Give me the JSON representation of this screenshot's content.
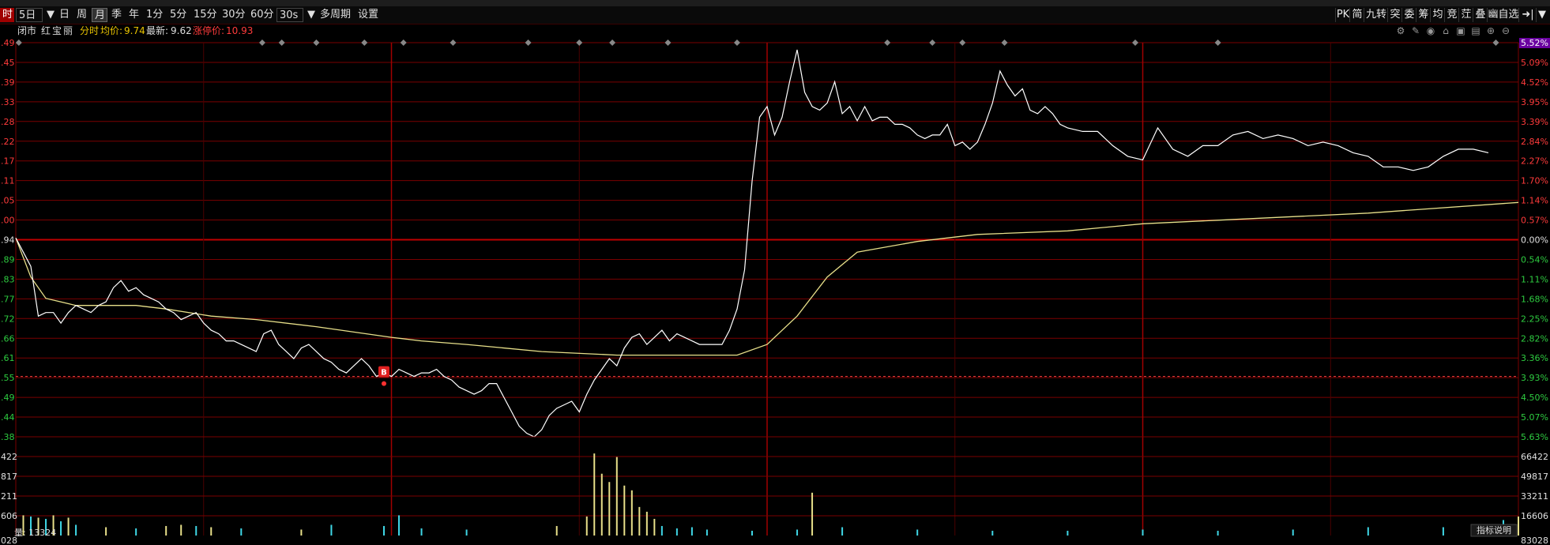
{
  "toolbar": {
    "left_items": [
      {
        "label": "时",
        "style": "red"
      },
      {
        "label": "5日",
        "style": "boxed"
      },
      {
        "label": "▼",
        "style": "plain"
      },
      {
        "label": "日",
        "style": "plain"
      },
      {
        "label": "周",
        "style": "plain"
      },
      {
        "label": "月",
        "style": "active"
      },
      {
        "label": "季",
        "style": "plain"
      },
      {
        "label": "年",
        "style": "plain"
      },
      {
        "label": "1分",
        "style": "plain"
      },
      {
        "label": "5分",
        "style": "plain"
      },
      {
        "label": "15分",
        "style": "plain"
      },
      {
        "label": "30分",
        "style": "plain"
      },
      {
        "label": "60分",
        "style": "plain"
      },
      {
        "label": "30s",
        "style": "boxed"
      },
      {
        "label": "▼",
        "style": "plain"
      },
      {
        "label": "多周期",
        "style": "plain"
      },
      {
        "label": "设置",
        "style": "plain"
      }
    ],
    "right_items": [
      "PK",
      "简",
      "九转",
      "突",
      "委",
      "筹",
      "均",
      "竞",
      "茳",
      "叠",
      "幽自选",
      "➜|",
      "▼"
    ]
  },
  "info": {
    "market": "闭市",
    "stock_name": "红宝丽",
    "mode": "分时",
    "avg_label": "均价:",
    "avg_value": "9.74",
    "last_label": "最新:",
    "last_value": "9.62",
    "limit_label": "涨停价:",
    "limit_value": "10.93"
  },
  "icons": [
    "gear-icon",
    "pen-icon",
    "eye-icon",
    "lock-icon",
    "trash-icon",
    "copy-icon",
    "zoom-in-icon",
    "zoom-out-icon"
  ],
  "colors": {
    "up": "#ff3b3b",
    "down": "#2ecc40",
    "flat": "#e0e0e0",
    "price_line": "#ffffff",
    "avg_line": "#e8e08a",
    "vol_up": "#e8e08a",
    "vol_down": "#3fd7e6",
    "grid": "#7a0000"
  },
  "chart_data": {
    "type": "line",
    "title": "",
    "prev_close": 9.94,
    "ylim": [
      9.38,
      10.49
    ],
    "price_ticks_left": [
      ".49",
      ".45",
      ".39",
      ".33",
      ".28",
      ".22",
      ".17",
      ".11",
      ".05",
      ".00",
      ".94",
      ".89",
      ".83",
      ".77",
      ".72",
      ".66",
      ".61",
      ".55",
      ".49",
      ".44",
      ".38"
    ],
    "percent_ticks_right": [
      "5.52%",
      "5.09%",
      "4.52%",
      "3.95%",
      "3.39%",
      "2.84%",
      "2.27%",
      "1.70%",
      "1.14%",
      "0.57%",
      "0.00%",
      "0.54%",
      "1.11%",
      "1.68%",
      "2.25%",
      "2.82%",
      "3.36%",
      "3.93%",
      "4.50%",
      "5.07%",
      "5.63%"
    ],
    "day_boundaries": [
      0.25,
      0.5,
      0.75
    ],
    "price_series": {
      "name": "",
      "x": [
        0,
        0.01,
        0.015,
        0.02,
        0.025,
        0.03,
        0.035,
        0.04,
        0.045,
        0.05,
        0.055,
        0.06,
        0.065,
        0.07,
        0.075,
        0.08,
        0.085,
        0.09,
        0.095,
        0.1,
        0.105,
        0.11,
        0.115,
        0.12,
        0.125,
        0.13,
        0.135,
        0.14,
        0.145,
        0.15,
        0.155,
        0.16,
        0.165,
        0.17,
        0.175,
        0.18,
        0.185,
        0.19,
        0.195,
        0.2,
        0.205,
        0.21,
        0.215,
        0.22,
        0.225,
        0.23,
        0.235,
        0.24,
        0.245,
        0.25,
        0.255,
        0.26,
        0.265,
        0.27,
        0.275,
        0.28,
        0.285,
        0.29,
        0.295,
        0.3,
        0.305,
        0.31,
        0.315,
        0.32,
        0.325,
        0.33,
        0.335,
        0.34,
        0.345,
        0.35,
        0.355,
        0.36,
        0.365,
        0.37,
        0.375,
        0.38,
        0.385,
        0.39,
        0.395,
        0.4,
        0.405,
        0.41,
        0.415,
        0.42,
        0.425,
        0.43,
        0.435,
        0.44,
        0.445,
        0.45,
        0.455,
        0.46,
        0.465,
        0.47,
        0.475,
        0.48,
        0.485,
        0.49,
        0.495,
        0.5,
        0.505,
        0.51,
        0.515,
        0.52,
        0.525,
        0.53,
        0.535,
        0.54,
        0.545,
        0.55,
        0.555,
        0.56,
        0.565,
        0.57,
        0.575,
        0.58,
        0.585,
        0.59,
        0.595,
        0.6,
        0.605,
        0.61,
        0.615,
        0.62,
        0.625,
        0.63,
        0.635,
        0.64,
        0.645,
        0.65,
        0.655,
        0.66,
        0.665,
        0.67,
        0.675,
        0.68,
        0.685,
        0.69,
        0.695,
        0.7,
        0.71,
        0.72,
        0.73,
        0.74,
        0.75,
        0.76,
        0.77,
        0.78,
        0.79,
        0.8,
        0.81,
        0.82,
        0.83,
        0.84,
        0.85,
        0.86,
        0.87,
        0.88,
        0.89,
        0.9,
        0.91,
        0.92,
        0.93,
        0.94,
        0.95,
        0.96,
        0.97,
        0.98,
        0.99,
        1.0
      ],
      "y": [
        9.94,
        9.86,
        9.72,
        9.73,
        9.73,
        9.7,
        9.73,
        9.75,
        9.74,
        9.73,
        9.75,
        9.76,
        9.8,
        9.82,
        9.79,
        9.8,
        9.78,
        9.77,
        9.76,
        9.74,
        9.73,
        9.71,
        9.72,
        9.73,
        9.7,
        9.68,
        9.67,
        9.65,
        9.65,
        9.64,
        9.63,
        9.62,
        9.67,
        9.68,
        9.64,
        9.62,
        9.6,
        9.63,
        9.64,
        9.62,
        9.6,
        9.59,
        9.57,
        9.56,
        9.58,
        9.6,
        9.58,
        9.55,
        9.56,
        9.55,
        9.57,
        9.56,
        9.55,
        9.56,
        9.56,
        9.57,
        9.55,
        9.54,
        9.52,
        9.51,
        9.5,
        9.51,
        9.53,
        9.53,
        9.49,
        9.45,
        9.41,
        9.39,
        9.38,
        9.4,
        9.44,
        9.46,
        9.47,
        9.48,
        9.45,
        9.5,
        9.54,
        9.57,
        9.6,
        9.58,
        9.63,
        9.66,
        9.67,
        9.64,
        9.66,
        9.68,
        9.65,
        9.67,
        9.66,
        9.65,
        9.64,
        9.64,
        9.64,
        9.64,
        9.68,
        9.74,
        9.85,
        10.1,
        10.28,
        10.31,
        10.23,
        10.28,
        10.38,
        10.47,
        10.35,
        10.31,
        10.3,
        10.32,
        10.38,
        10.29,
        10.31,
        10.27,
        10.31,
        10.27,
        10.28,
        10.28,
        10.26,
        10.26,
        10.25,
        10.23,
        10.22,
        10.23,
        10.23,
        10.26,
        10.2,
        10.21,
        10.19,
        10.21,
        10.26,
        10.32,
        10.41,
        10.37,
        10.34,
        10.36,
        10.3,
        10.29,
        10.31,
        10.29,
        10.26,
        10.25,
        10.24,
        10.24,
        10.2,
        10.17,
        10.16,
        10.25,
        10.19,
        10.17,
        10.2,
        10.2,
        10.23,
        10.24,
        10.22,
        10.23,
        10.22,
        10.2,
        10.21,
        10.2,
        10.18,
        10.17,
        10.14,
        10.14,
        10.13,
        10.14,
        10.17,
        10.19,
        10.19,
        10.18
      ],
      "color": "#ffffff"
    },
    "avg_series": {
      "name": "",
      "x": [
        0,
        0.01,
        0.02,
        0.04,
        0.06,
        0.08,
        0.1,
        0.13,
        0.16,
        0.2,
        0.25,
        0.27,
        0.3,
        0.35,
        0.4,
        0.48,
        0.5,
        0.52,
        0.54,
        0.56,
        0.6,
        0.64,
        0.7,
        0.75,
        0.8,
        0.9,
        1.0
      ],
      "y": [
        9.94,
        9.83,
        9.77,
        9.75,
        9.75,
        9.75,
        9.74,
        9.72,
        9.71,
        9.69,
        9.66,
        9.65,
        9.64,
        9.62,
        9.61,
        9.61,
        9.64,
        9.72,
        9.83,
        9.9,
        9.93,
        9.95,
        9.96,
        9.98,
        9.99,
        10.01,
        10.04
      ],
      "color": "#e8e08a"
    },
    "buy_marker": {
      "label": "B",
      "x": 0.245,
      "y": 9.53
    },
    "volume": {
      "ylim": [
        0,
        83028
      ],
      "ticks": [
        "66422",
        "49817",
        "33211",
        "16606"
      ],
      "current_label": "量:",
      "current_value": "13324",
      "bottom_left": "028",
      "bottom_right": "83028",
      "left_partial_ticks": [
        "422",
        "817",
        "211",
        "606"
      ],
      "x": [
        0.005,
        0.01,
        0.015,
        0.02,
        0.025,
        0.03,
        0.035,
        0.04,
        0.06,
        0.08,
        0.1,
        0.11,
        0.12,
        0.13,
        0.15,
        0.19,
        0.21,
        0.245,
        0.255,
        0.27,
        0.3,
        0.36,
        0.38,
        0.385,
        0.39,
        0.395,
        0.4,
        0.405,
        0.41,
        0.415,
        0.42,
        0.425,
        0.43,
        0.44,
        0.45,
        0.46,
        0.49,
        0.52,
        0.53,
        0.55,
        0.6,
        0.65,
        0.7,
        0.75,
        0.8,
        0.85,
        0.9,
        0.95,
        0.98,
        0.99,
        1.0
      ],
      "values": [
        17000,
        16000,
        15000,
        14000,
        17000,
        12000,
        15000,
        9000,
        7000,
        6000,
        8000,
        9000,
        8000,
        7000,
        6000,
        5000,
        9000,
        8000,
        17000,
        6000,
        5000,
        8000,
        16000,
        69000,
        52000,
        45000,
        66000,
        42000,
        38000,
        24000,
        20000,
        14000,
        8000,
        6000,
        7000,
        5000,
        4000,
        5000,
        36000,
        7000,
        5000,
        4000,
        4000,
        5000,
        4000,
        5000,
        7000,
        7000,
        9000,
        13000,
        16000
      ],
      "up": [
        true,
        false,
        true,
        false,
        true,
        false,
        true,
        false,
        true,
        false,
        true,
        true,
        false,
        true,
        false,
        true,
        false,
        false,
        false,
        false,
        false,
        true,
        true,
        true,
        true,
        true,
        true,
        true,
        true,
        true,
        true,
        true,
        false,
        false,
        false,
        false,
        false,
        false,
        true,
        false,
        false,
        false,
        false,
        false,
        false,
        false,
        false,
        false,
        false,
        false,
        true
      ]
    }
  },
  "footer": {
    "help_label": "指标说明"
  }
}
